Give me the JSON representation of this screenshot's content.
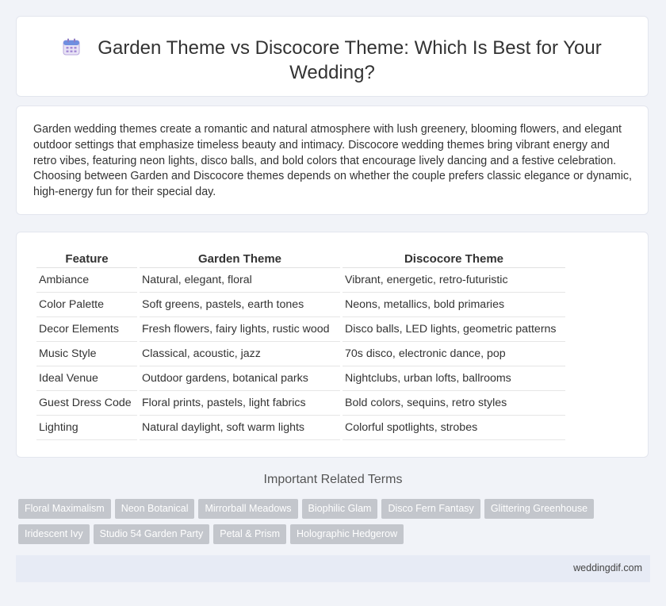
{
  "title": "Garden Theme vs Discocore Theme: Which Is Best for Your Wedding?",
  "icon": "calendar-icon",
  "intro": "Garden wedding themes create a romantic and natural atmosphere with lush greenery, blooming flowers, and elegant outdoor settings that emphasize timeless beauty and intimacy. Discocore wedding themes bring vibrant energy and retro vibes, featuring neon lights, disco balls, and bold colors that encourage lively dancing and a festive celebration. Choosing between Garden and Discocore themes depends on whether the couple prefers classic elegance or dynamic, high-energy fun for their special day.",
  "table": {
    "headers": [
      "Feature",
      "Garden Theme",
      "Discocore Theme"
    ],
    "rows": [
      [
        "Ambiance",
        "Natural, elegant, floral",
        "Vibrant, energetic, retro-futuristic"
      ],
      [
        "Color Palette",
        "Soft greens, pastels, earth tones",
        "Neons, metallics, bold primaries"
      ],
      [
        "Decor Elements",
        "Fresh flowers, fairy lights, rustic wood",
        "Disco balls, LED lights, geometric patterns"
      ],
      [
        "Music Style",
        "Classical, acoustic, jazz",
        "70s disco, electronic dance, pop"
      ],
      [
        "Ideal Venue",
        "Outdoor gardens, botanical parks",
        "Nightclubs, urban lofts, ballrooms"
      ],
      [
        "Guest Dress Code",
        "Floral prints, pastels, light fabrics",
        "Bold colors, sequins, retro styles"
      ],
      [
        "Lighting",
        "Natural daylight, soft warm lights",
        "Colorful spotlights, strobes"
      ]
    ]
  },
  "related": {
    "title": "Important Related Terms",
    "tags": [
      "Floral Maximalism",
      "Neon Botanical",
      "Mirrorball Meadows",
      "Biophilic Glam",
      "Disco Fern Fantasy",
      "Glittering Greenhouse",
      "Iridescent Ivy",
      "Studio 54 Garden Party",
      "Petal & Prism",
      "Holographic Hedgerow"
    ]
  },
  "footer": "weddingdif.com"
}
